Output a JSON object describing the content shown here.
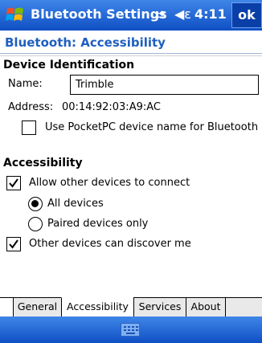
{
  "titlebar": {
    "title": "Bluetooth Settings",
    "time": "4:11",
    "ok_label": "ok"
  },
  "header": {
    "subtitle": "Bluetooth: Accessibility"
  },
  "device_identification": {
    "heading": "Device Identification",
    "name_label": "Name:",
    "name_value": "Trimble",
    "address_label": "Address:",
    "address_value": "00:14:92:03:A9:AC",
    "use_pocketpc_label": "Use PocketPC device name for Bluetooth",
    "use_pocketpc_checked": false
  },
  "accessibility": {
    "heading": "Accessibility",
    "allow_connect_label": "Allow other devices to connect",
    "allow_connect_checked": true,
    "all_devices_label": "All devices",
    "paired_only_label": "Paired devices only",
    "selected_option": "All devices",
    "discover_label": "Other devices can discover me",
    "discover_checked": true
  },
  "tabs": [
    {
      "label": "General"
    },
    {
      "label": "Accessibility",
      "active": true
    },
    {
      "label": "Services"
    },
    {
      "label": "About"
    }
  ],
  "icons": {
    "start": "windows-logo-icon",
    "connectivity": "connectivity-icon",
    "volume": "speaker-icon",
    "input": "keyboard-icon"
  },
  "colors": {
    "accent": "#1f5fbf",
    "titlebar": "#2a6fd8"
  }
}
